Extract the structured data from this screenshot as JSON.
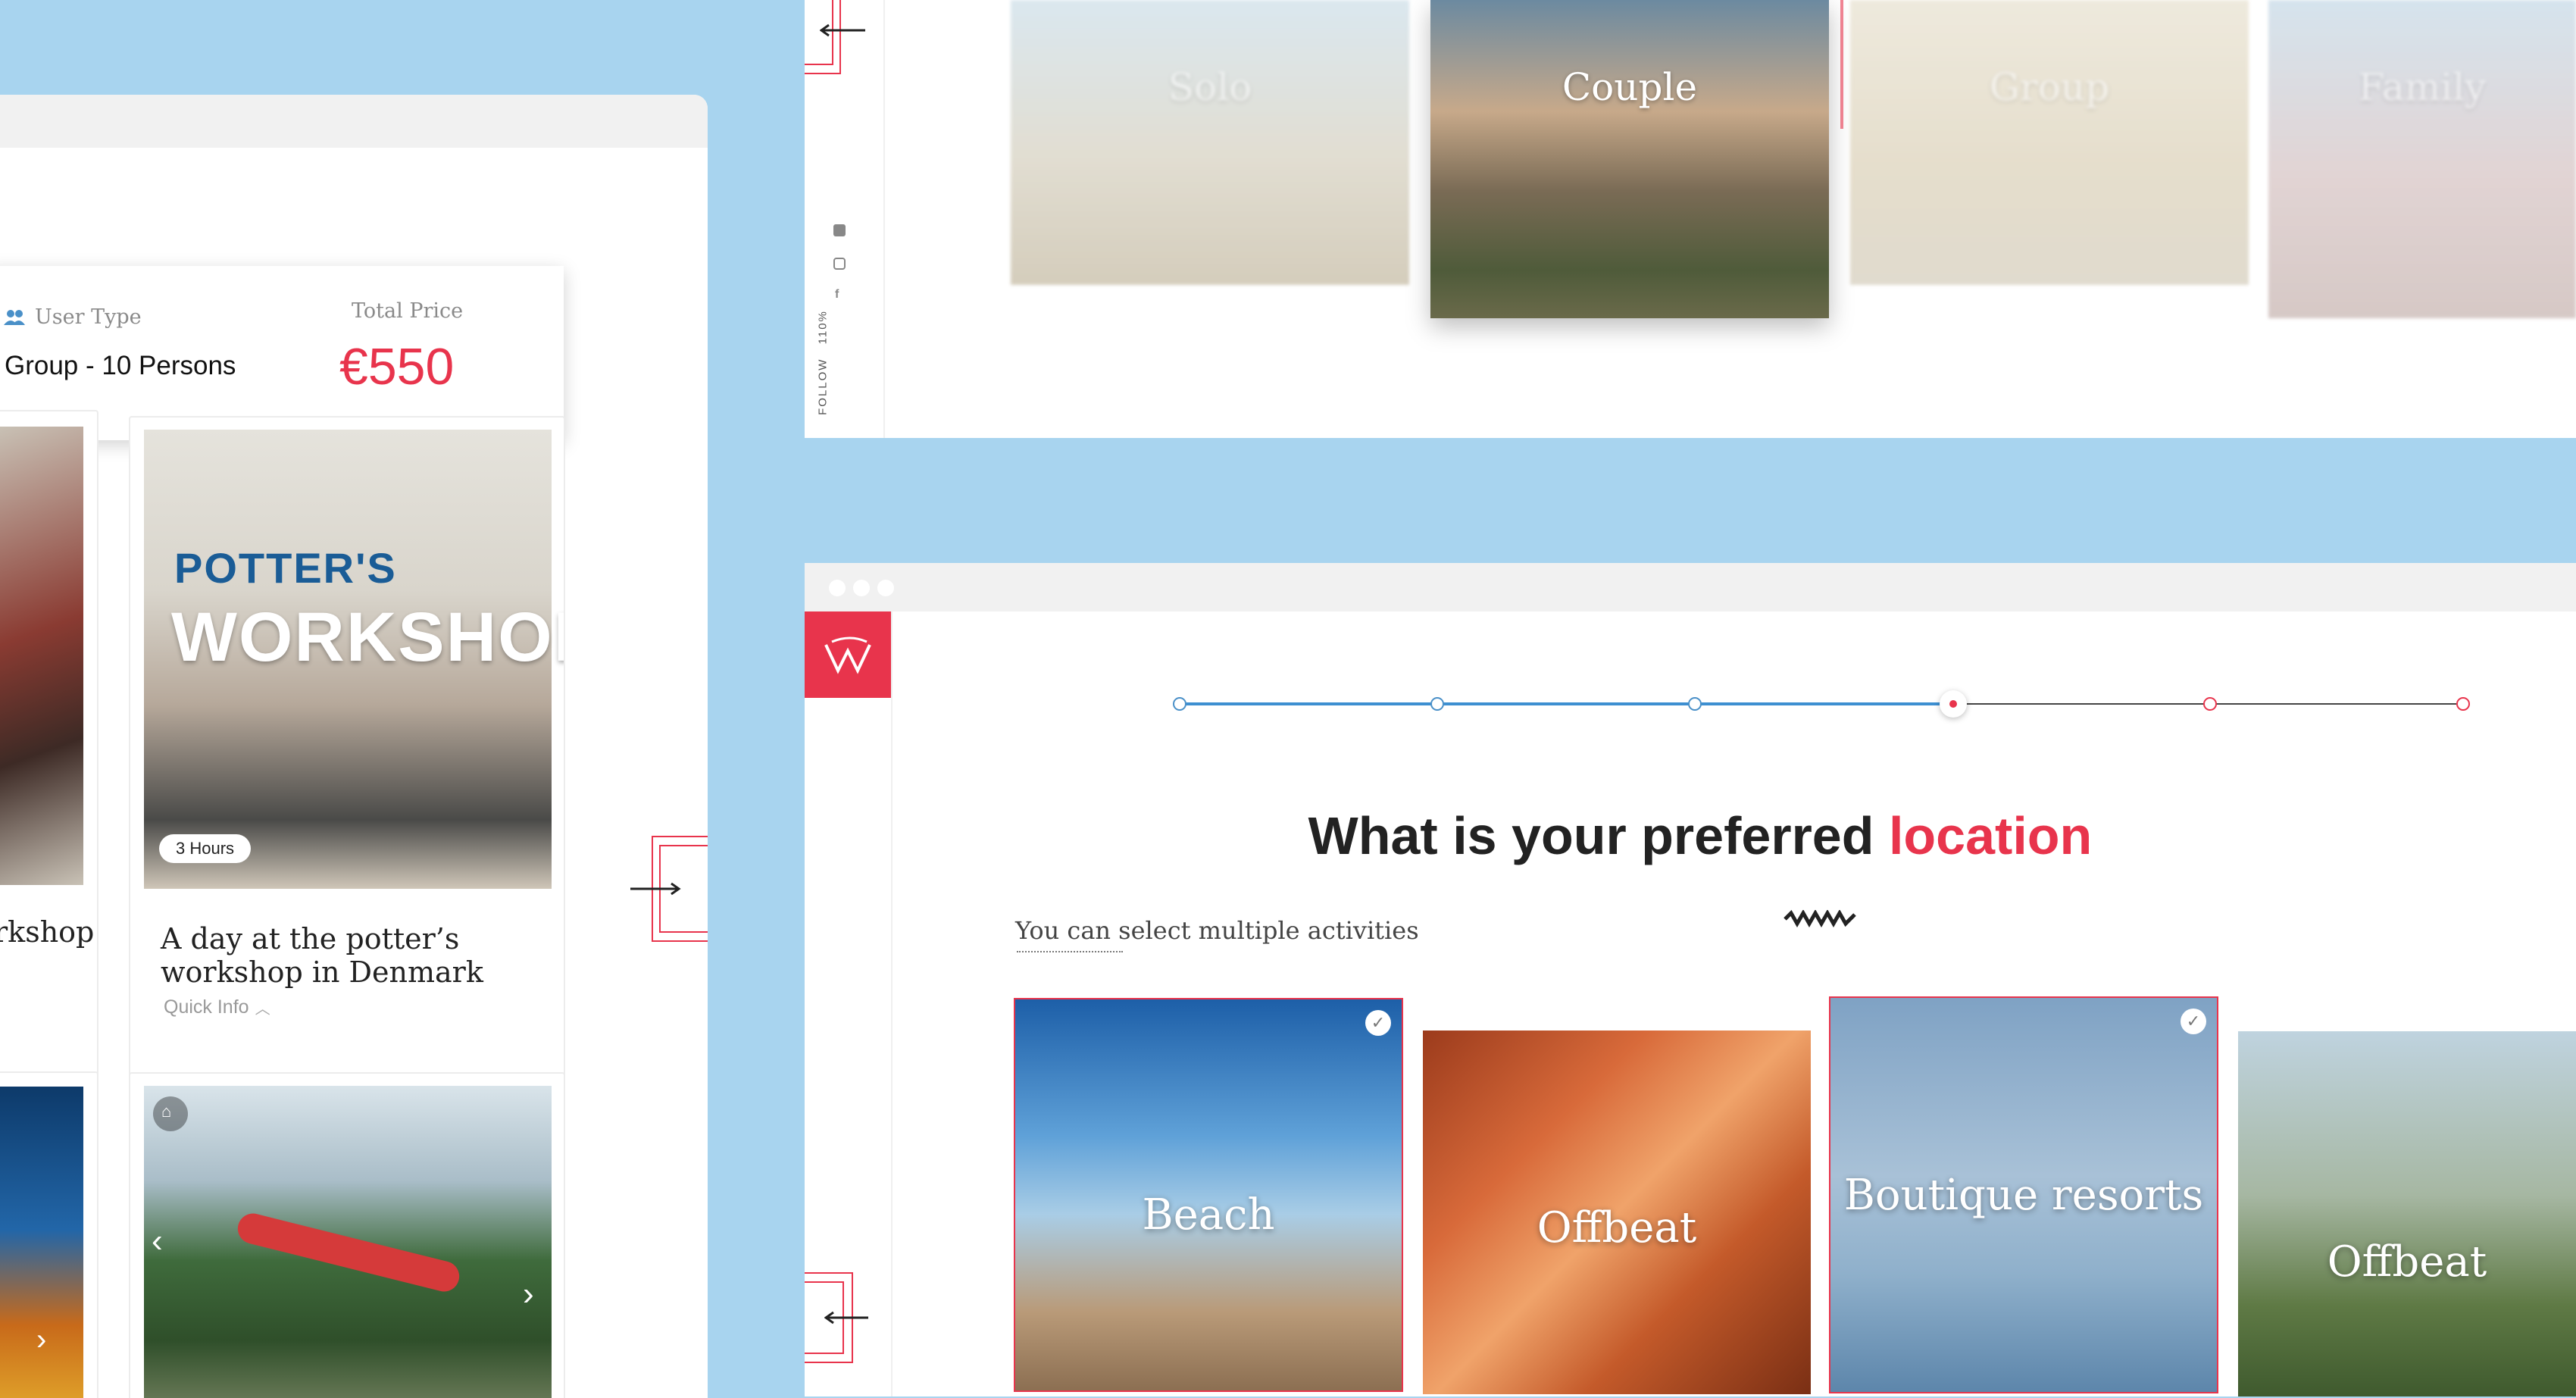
{
  "colors": {
    "accent": "#e8344c",
    "progress_blue": "#3d8fd1",
    "background": "#a8d4ef"
  },
  "left": {
    "summary": {
      "user_type_label": "User  Type",
      "user_type_value": "Group - 10 Persons",
      "total_price_label": "Total Price",
      "total_price_value": "€550"
    },
    "cards": [
      {
        "title_partial": "rkshop"
      },
      {
        "image_title_line1": "POTTER'S",
        "image_title_line2": "WORKSHOP",
        "duration": "3 Hours",
        "title": "A day at the potter’s workshop in Denmark",
        "quick_info": "Quick Info"
      }
    ]
  },
  "top": {
    "sidebar": {
      "follow": "FOLLOW",
      "zoom": "110%"
    },
    "user_types": [
      "Solo",
      "Couple",
      "Group",
      "Family"
    ],
    "selected_user_type": "Couple"
  },
  "bottom": {
    "progress": {
      "steps": 6,
      "current_step": 4
    },
    "question_prefix": "What is your preferred",
    "question_highlight": "location",
    "hint": "You can select multiple activities",
    "locations": [
      {
        "label": "Beach",
        "selected": true
      },
      {
        "label": "Offbeat",
        "selected": false
      },
      {
        "label": "Boutique resorts",
        "selected": true
      },
      {
        "label": "Offbeat",
        "selected": false
      }
    ]
  }
}
